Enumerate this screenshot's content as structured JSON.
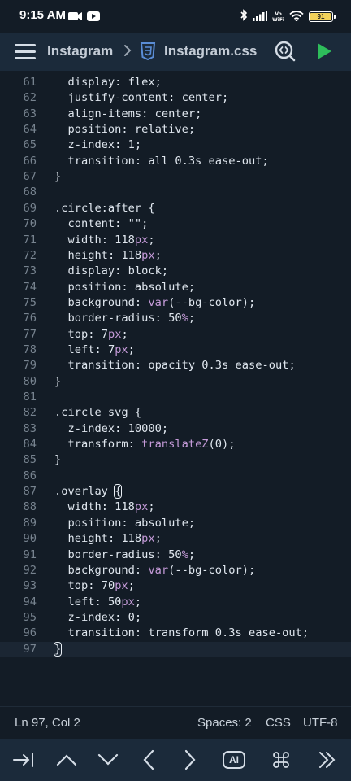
{
  "status_bar": {
    "time": "9:15 AM",
    "network_label_top": "Vo",
    "network_label_bottom": "WiFi",
    "battery_level": "91",
    "battery_fraction": 0.91,
    "icons": [
      "camera-icon",
      "youtube-icon",
      "bluetooth-icon",
      "signal-icon",
      "wifi-icon",
      "battery-icon"
    ]
  },
  "toolbar": {
    "project": "Instagram",
    "file": "Instagram.css",
    "icons": [
      "menu-icon",
      "chevron-right-icon",
      "css-file-icon",
      "search-icon",
      "play-icon"
    ]
  },
  "editor": {
    "lines": [
      {
        "n": "61",
        "indent": 1,
        "tokens": [
          [
            "p",
            "display"
          ],
          [
            "c",
            ": "
          ],
          [
            "v",
            "flex"
          ],
          [
            "c",
            ";"
          ]
        ]
      },
      {
        "n": "62",
        "indent": 1,
        "tokens": [
          [
            "p",
            "justify-content"
          ],
          [
            "c",
            ": "
          ],
          [
            "v",
            "center"
          ],
          [
            "c",
            ";"
          ]
        ]
      },
      {
        "n": "63",
        "indent": 1,
        "tokens": [
          [
            "p",
            "align-items"
          ],
          [
            "c",
            ": "
          ],
          [
            "v",
            "center"
          ],
          [
            "c",
            ";"
          ]
        ]
      },
      {
        "n": "64",
        "indent": 1,
        "tokens": [
          [
            "p",
            "position"
          ],
          [
            "c",
            ": "
          ],
          [
            "v",
            "relative"
          ],
          [
            "c",
            ";"
          ]
        ]
      },
      {
        "n": "65",
        "indent": 1,
        "tokens": [
          [
            "p",
            "z-index"
          ],
          [
            "c",
            ": "
          ],
          [
            "v",
            "1"
          ],
          [
            "c",
            ";"
          ]
        ]
      },
      {
        "n": "66",
        "indent": 1,
        "tokens": [
          [
            "p",
            "transition"
          ],
          [
            "c",
            ": "
          ],
          [
            "v",
            "all 0.3s ease-out"
          ],
          [
            "c",
            ";"
          ]
        ]
      },
      {
        "n": "67",
        "indent": 0,
        "tokens": [
          [
            "c",
            "}"
          ]
        ]
      },
      {
        "n": "68",
        "indent": 0,
        "tokens": []
      },
      {
        "n": "69",
        "indent": 0,
        "tokens": [
          [
            "s",
            ".circle:after"
          ],
          [
            "c",
            " {"
          ]
        ]
      },
      {
        "n": "70",
        "indent": 1,
        "tokens": [
          [
            "p",
            "content"
          ],
          [
            "c",
            ": "
          ],
          [
            "v",
            "\"\""
          ],
          [
            "c",
            ";"
          ]
        ]
      },
      {
        "n": "71",
        "indent": 1,
        "tokens": [
          [
            "p",
            "width"
          ],
          [
            "c",
            ": "
          ],
          [
            "v",
            "118"
          ],
          [
            "u",
            "px"
          ],
          [
            "c",
            ";"
          ]
        ]
      },
      {
        "n": "72",
        "indent": 1,
        "tokens": [
          [
            "p",
            "height"
          ],
          [
            "c",
            ": "
          ],
          [
            "v",
            "118"
          ],
          [
            "u",
            "px"
          ],
          [
            "c",
            ";"
          ]
        ]
      },
      {
        "n": "73",
        "indent": 1,
        "tokens": [
          [
            "p",
            "display"
          ],
          [
            "c",
            ": "
          ],
          [
            "v",
            "block"
          ],
          [
            "c",
            ";"
          ]
        ]
      },
      {
        "n": "74",
        "indent": 1,
        "tokens": [
          [
            "p",
            "position"
          ],
          [
            "c",
            ": "
          ],
          [
            "v",
            "absolute"
          ],
          [
            "c",
            ";"
          ]
        ]
      },
      {
        "n": "75",
        "indent": 1,
        "tokens": [
          [
            "p",
            "background"
          ],
          [
            "c",
            ": "
          ],
          [
            "f",
            "var"
          ],
          [
            "v",
            "(--bg-color)"
          ],
          [
            "c",
            ";"
          ]
        ]
      },
      {
        "n": "76",
        "indent": 1,
        "tokens": [
          [
            "p",
            "border-radius"
          ],
          [
            "c",
            ": "
          ],
          [
            "v",
            "50"
          ],
          [
            "u",
            "%"
          ],
          [
            "c",
            ";"
          ]
        ]
      },
      {
        "n": "77",
        "indent": 1,
        "tokens": [
          [
            "p",
            "top"
          ],
          [
            "c",
            ": "
          ],
          [
            "v",
            "7"
          ],
          [
            "u",
            "px"
          ],
          [
            "c",
            ";"
          ]
        ]
      },
      {
        "n": "78",
        "indent": 1,
        "tokens": [
          [
            "p",
            "left"
          ],
          [
            "c",
            ": "
          ],
          [
            "v",
            "7"
          ],
          [
            "u",
            "px"
          ],
          [
            "c",
            ";"
          ]
        ]
      },
      {
        "n": "79",
        "indent": 1,
        "tokens": [
          [
            "p",
            "transition"
          ],
          [
            "c",
            ": "
          ],
          [
            "v",
            "opacity 0.3s ease-out"
          ],
          [
            "c",
            ";"
          ]
        ]
      },
      {
        "n": "80",
        "indent": 0,
        "tokens": [
          [
            "c",
            "}"
          ]
        ]
      },
      {
        "n": "81",
        "indent": 0,
        "tokens": []
      },
      {
        "n": "82",
        "indent": 0,
        "tokens": [
          [
            "s",
            ".circle svg"
          ],
          [
            "c",
            " {"
          ]
        ]
      },
      {
        "n": "83",
        "indent": 1,
        "tokens": [
          [
            "p",
            "z-index"
          ],
          [
            "c",
            ": "
          ],
          [
            "v",
            "10000"
          ],
          [
            "c",
            ";"
          ]
        ]
      },
      {
        "n": "84",
        "indent": 1,
        "tokens": [
          [
            "p",
            "transform"
          ],
          [
            "c",
            ": "
          ],
          [
            "f",
            "translateZ"
          ],
          [
            "v",
            "(0)"
          ],
          [
            "c",
            ";"
          ]
        ]
      },
      {
        "n": "85",
        "indent": 0,
        "tokens": [
          [
            "c",
            "}"
          ]
        ]
      },
      {
        "n": "86",
        "indent": 0,
        "tokens": []
      },
      {
        "n": "87",
        "indent": 0,
        "tokens": [
          [
            "s",
            ".overlay"
          ],
          [
            "c",
            " "
          ],
          [
            "b",
            "{"
          ]
        ]
      },
      {
        "n": "88",
        "indent": 1,
        "tokens": [
          [
            "p",
            "width"
          ],
          [
            "c",
            ": "
          ],
          [
            "v",
            "118"
          ],
          [
            "u",
            "px"
          ],
          [
            "c",
            ";"
          ]
        ]
      },
      {
        "n": "89",
        "indent": 1,
        "tokens": [
          [
            "p",
            "position"
          ],
          [
            "c",
            ": "
          ],
          [
            "v",
            "absolute"
          ],
          [
            "c",
            ";"
          ]
        ]
      },
      {
        "n": "90",
        "indent": 1,
        "tokens": [
          [
            "p",
            "height"
          ],
          [
            "c",
            ": "
          ],
          [
            "v",
            "118"
          ],
          [
            "u",
            "px"
          ],
          [
            "c",
            ";"
          ]
        ]
      },
      {
        "n": "91",
        "indent": 1,
        "tokens": [
          [
            "p",
            "border-radius"
          ],
          [
            "c",
            ": "
          ],
          [
            "v",
            "50"
          ],
          [
            "u",
            "%"
          ],
          [
            "c",
            ";"
          ]
        ]
      },
      {
        "n": "92",
        "indent": 1,
        "tokens": [
          [
            "p",
            "background"
          ],
          [
            "c",
            ": "
          ],
          [
            "f",
            "var"
          ],
          [
            "v",
            "(--bg-color)"
          ],
          [
            "c",
            ";"
          ]
        ]
      },
      {
        "n": "93",
        "indent": 1,
        "tokens": [
          [
            "p",
            "top"
          ],
          [
            "c",
            ": "
          ],
          [
            "v",
            "70"
          ],
          [
            "u",
            "px"
          ],
          [
            "c",
            ";"
          ]
        ]
      },
      {
        "n": "94",
        "indent": 1,
        "tokens": [
          [
            "p",
            "left"
          ],
          [
            "c",
            ": "
          ],
          [
            "v",
            "50"
          ],
          [
            "u",
            "px"
          ],
          [
            "c",
            ";"
          ]
        ]
      },
      {
        "n": "95",
        "indent": 1,
        "tokens": [
          [
            "p",
            "z-index"
          ],
          [
            "c",
            ": "
          ],
          [
            "v",
            "0"
          ],
          [
            "c",
            ";"
          ]
        ]
      },
      {
        "n": "96",
        "indent": 1,
        "tokens": [
          [
            "p",
            "transition"
          ],
          [
            "c",
            ": "
          ],
          [
            "v",
            "transform 0.3s ease-out"
          ],
          [
            "c",
            ";"
          ]
        ]
      },
      {
        "n": "97",
        "indent": 0,
        "tokens": [
          [
            "b",
            "}"
          ]
        ],
        "current": true
      }
    ]
  },
  "footer": {
    "cursor_position": "Ln 97, Col 2",
    "indentation": "Spaces: 2",
    "language": "CSS",
    "encoding": "UTF-8"
  },
  "keybar": {
    "ai_label": "AI",
    "keys": [
      "tab-key-icon",
      "arrow-up-icon",
      "arrow-down-icon",
      "arrow-left-icon",
      "arrow-right-icon",
      "ai-key",
      "command-key-icon",
      "double-chevron-right-icon"
    ]
  },
  "colors": {
    "background": "#131c26",
    "toolbar": "#1b2a3a",
    "text": "#dfe6ee",
    "line_number": "#77838f",
    "unit_and_function": "#c59bd9",
    "run_button": "#2ebd5b",
    "file_icon": "#5a8dd6",
    "battery": "#f2d25a"
  }
}
